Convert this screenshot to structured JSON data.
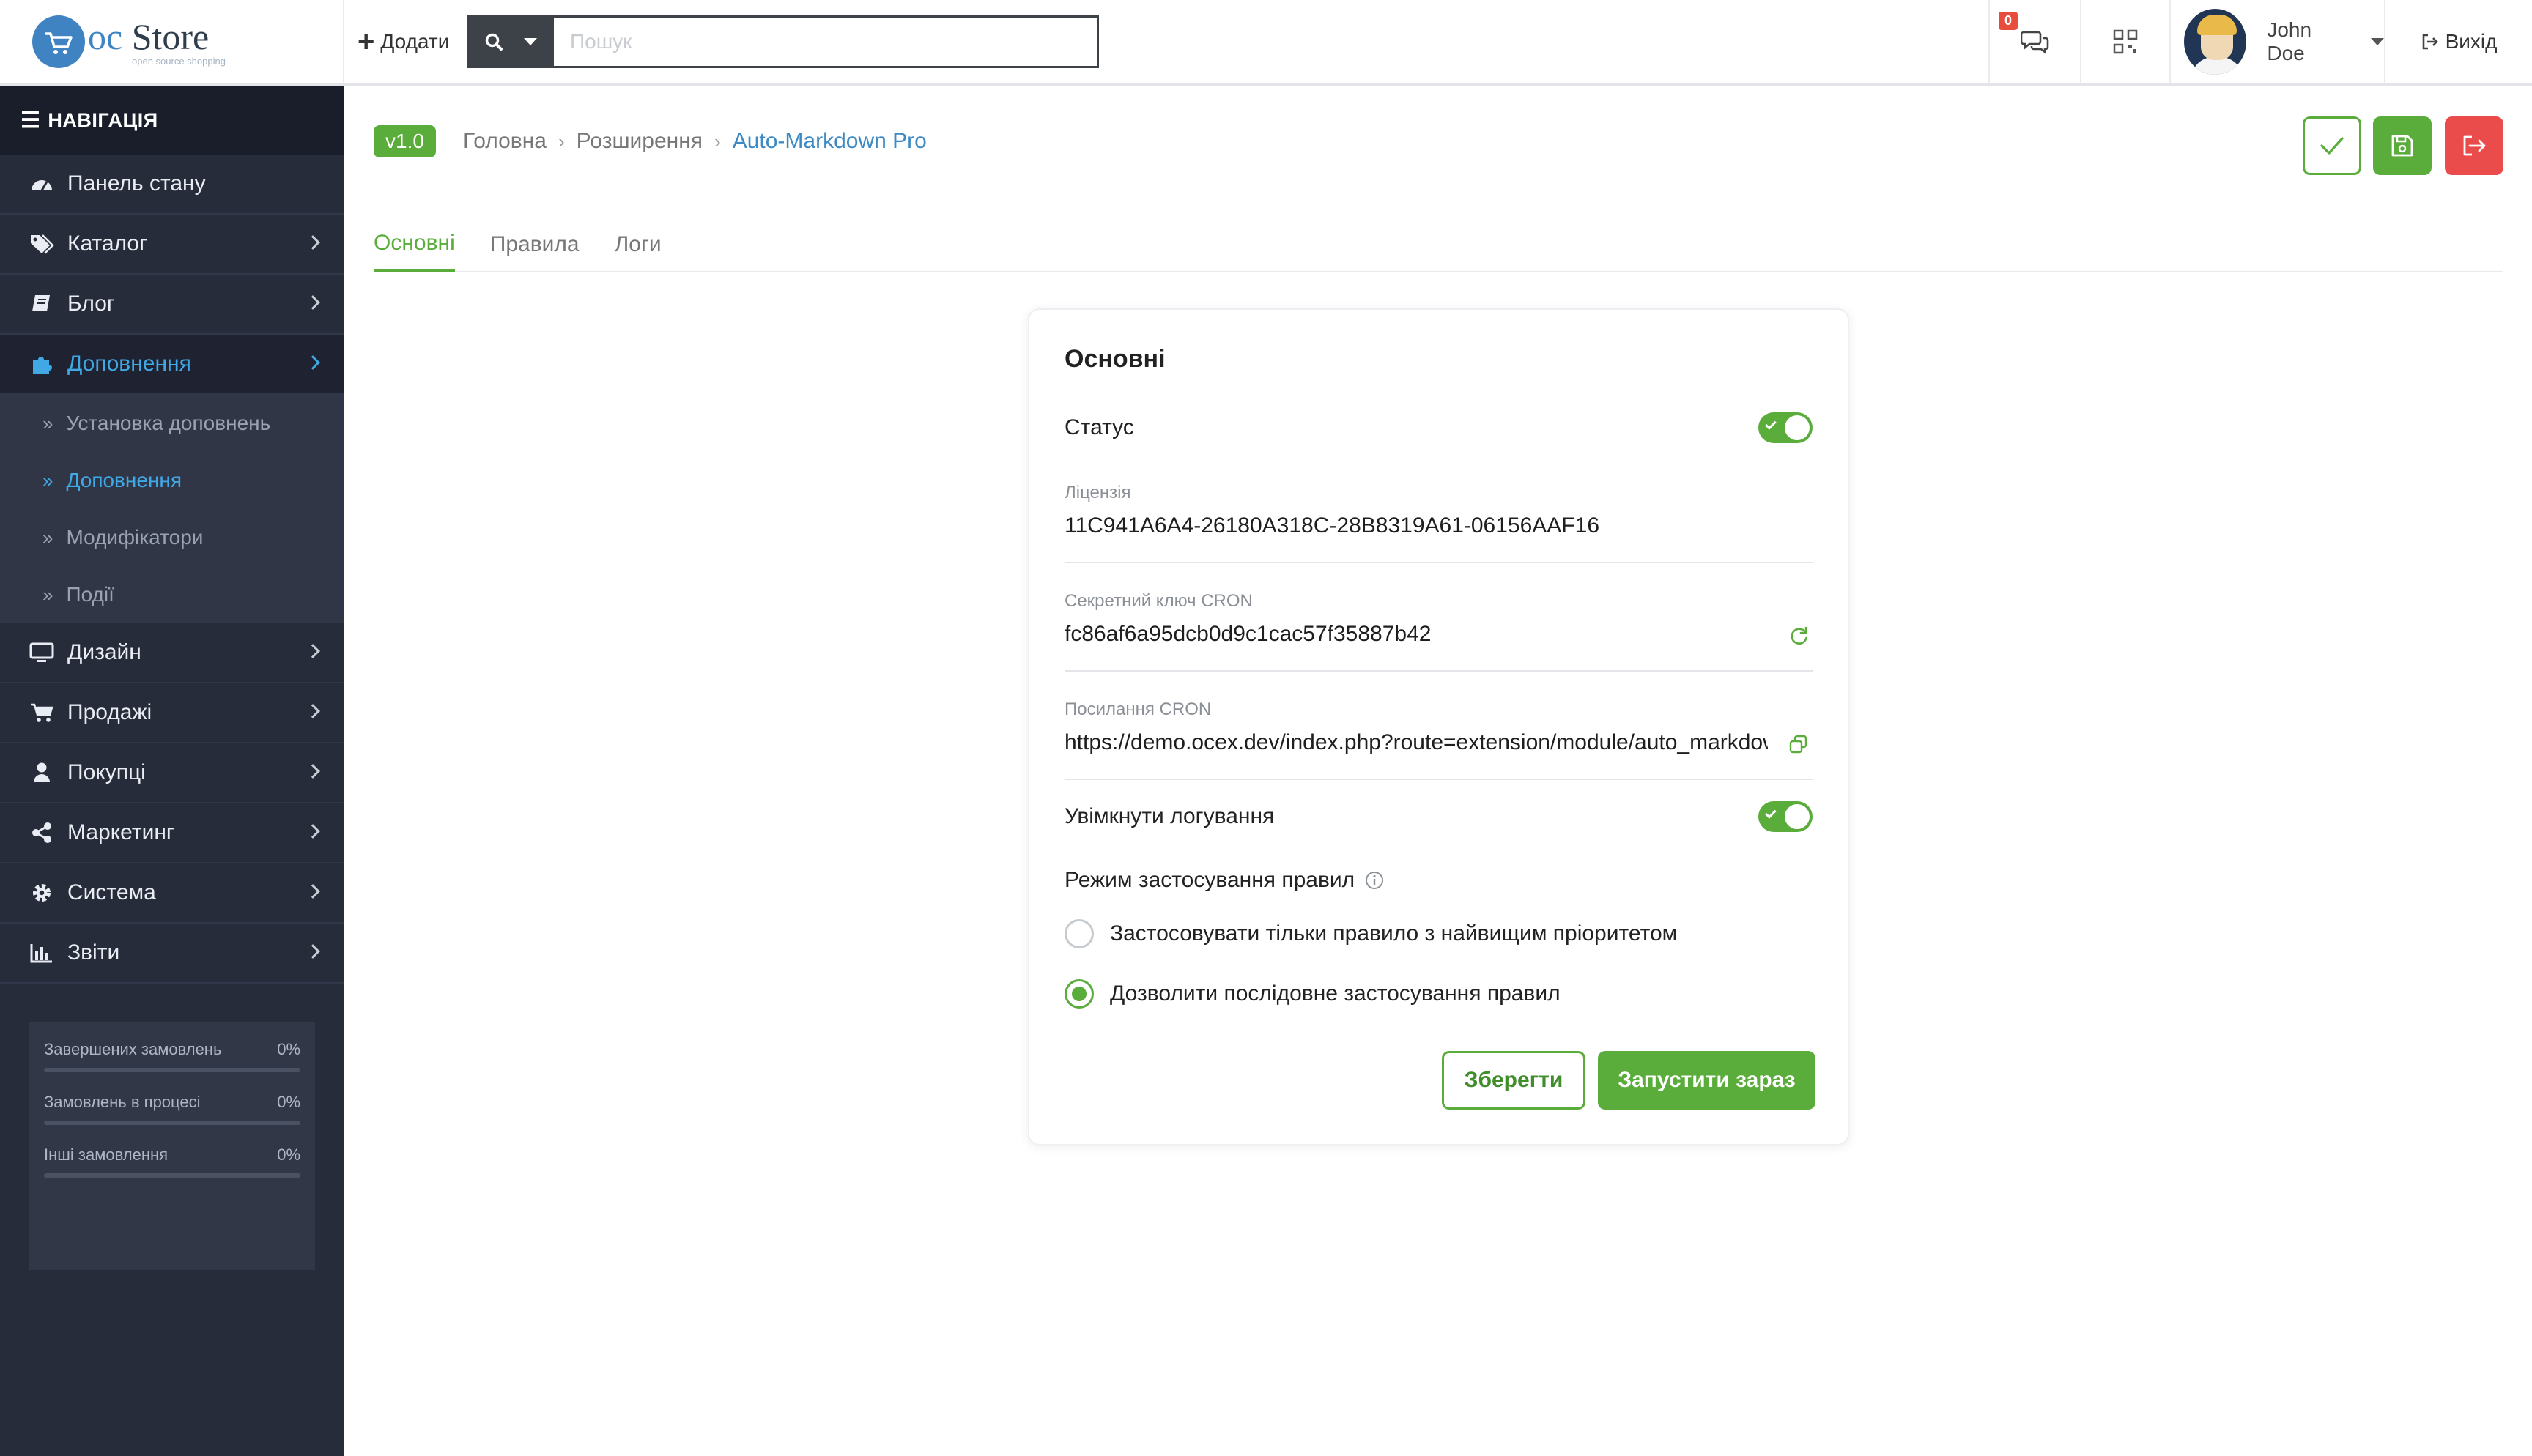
{
  "header": {
    "logo": {
      "oc": "oc",
      "store": "Store",
      "tagline": "open source shopping"
    },
    "add_label": "Додати",
    "search_placeholder": "Пошук",
    "messages_badge": "0",
    "user_name": "John Doe",
    "logout_label": "Вихід"
  },
  "sidebar": {
    "nav_title": "НАВІГАЦІЯ",
    "items": [
      {
        "label": "Панель стану",
        "icon": "dashboard-icon",
        "has_children": false
      },
      {
        "label": "Каталог",
        "icon": "tags-icon",
        "has_children": true
      },
      {
        "label": "Блог",
        "icon": "book-icon",
        "has_children": true
      },
      {
        "label": "Доповнення",
        "icon": "puzzle-icon",
        "has_children": true,
        "active": true
      },
      {
        "label": "Дизайн",
        "icon": "monitor-icon",
        "has_children": true
      },
      {
        "label": "Продажі",
        "icon": "cart-icon",
        "has_children": true
      },
      {
        "label": "Покупці",
        "icon": "user-icon",
        "has_children": true
      },
      {
        "label": "Маркетинг",
        "icon": "share-icon",
        "has_children": true
      },
      {
        "label": "Система",
        "icon": "cog-icon",
        "has_children": true
      },
      {
        "label": "Звіти",
        "icon": "bar-chart-icon",
        "has_children": true
      }
    ],
    "sub_items": [
      {
        "label": "Установка доповнень",
        "active": false
      },
      {
        "label": "Доповнення",
        "active": true
      },
      {
        "label": "Модифікатори",
        "active": false
      },
      {
        "label": "Події",
        "active": false
      }
    ],
    "stats": [
      {
        "label": "Завершених замовлень",
        "value": "0%"
      },
      {
        "label": "Замовлень в процесі",
        "value": "0%"
      },
      {
        "label": "Інші замовлення",
        "value": "0%"
      }
    ]
  },
  "page": {
    "version": "v1.0",
    "breadcrumb": [
      "Головна",
      "Розширення",
      "Auto-Markdown Pro"
    ],
    "tabs": [
      "Основні",
      "Правила",
      "Логи"
    ],
    "active_tab": 0
  },
  "card": {
    "title": "Основні",
    "status_label": "Статус",
    "status_on": true,
    "license_label": "Ліцензія",
    "license_value": "11C941A6A4-26180A318C-28B8319A61-06156AAF16",
    "cron_key_label": "Секретний ключ CRON",
    "cron_key_value": "fc86af6a95dcb0d9c1cac57f35887b42",
    "cron_url_label": "Посилання CRON",
    "cron_url_value": "https://demo.ocex.dev/index.php?route=extension/module/auto_markdown",
    "logging_label": "Увімкнути логування",
    "logging_on": true,
    "mode_label": "Режим застосування правил",
    "mode_options": [
      "Застосовувати тільки правило з найвищим пріоритетом",
      "Дозволити послідовне застосування правил"
    ],
    "mode_selected": 1,
    "save_button": "Зберегти",
    "run_button": "Запустити зараз"
  },
  "colors": {
    "accent_green": "#5aac3b",
    "danger_red": "#ea4b4b",
    "sidebar_bg": "#272c3a",
    "link_blue": "#41a8e6"
  }
}
